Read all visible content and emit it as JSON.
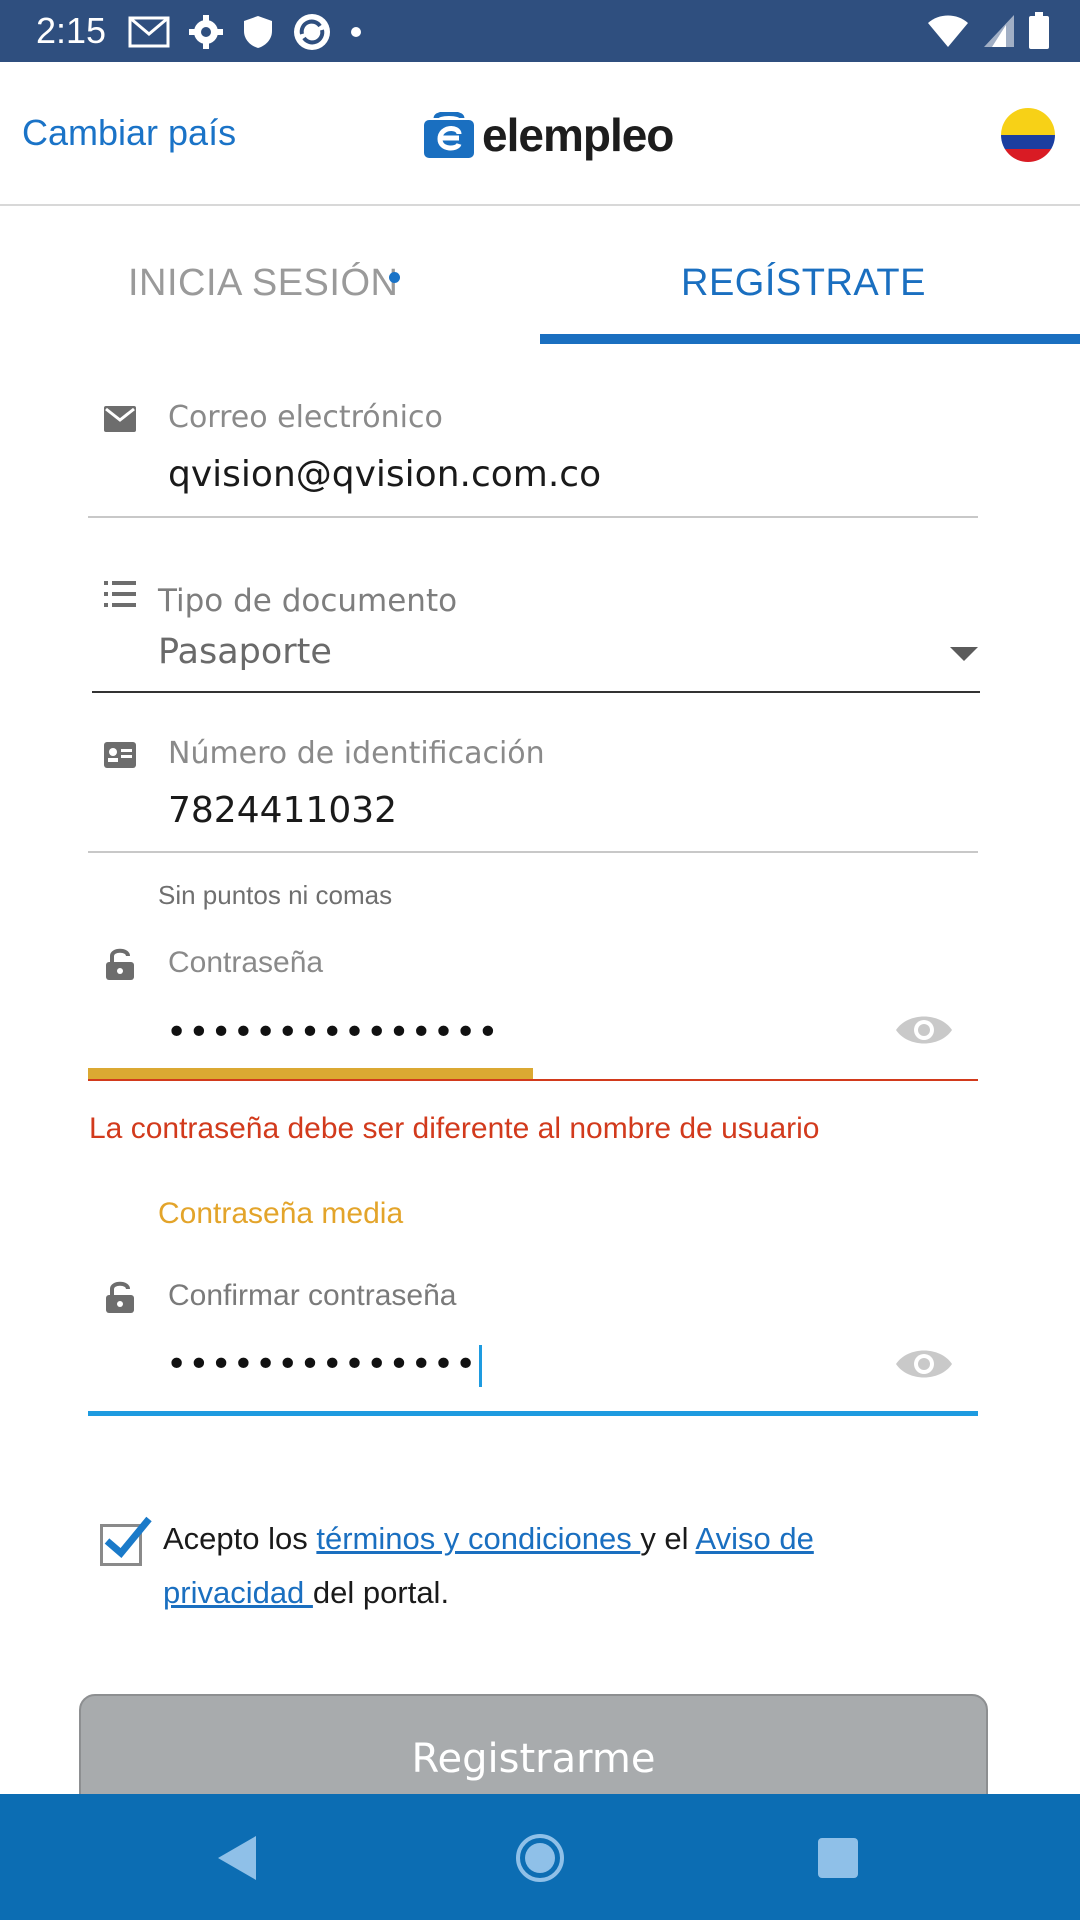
{
  "status_bar": {
    "time": "2:15",
    "left_icons": [
      "gmail-icon",
      "settings-icon",
      "shield-icon",
      "sync-icon",
      "dot-icon"
    ],
    "right_icons": [
      "wifi-icon",
      "signal-icon",
      "battery-icon"
    ]
  },
  "header": {
    "change_country_label": "Cambiar país",
    "logo_text": "elempleo",
    "flag": "colombia-flag"
  },
  "tabs": {
    "login_label": "INICIA SESIÓN",
    "register_label": "REGÍSTRATE",
    "active": "register"
  },
  "form": {
    "email": {
      "label": "Correo electrónico",
      "value": "qvision@qvision.com.co",
      "icon": "envelope-icon"
    },
    "document_type": {
      "label": "Tipo de documento",
      "value": "Pasaporte",
      "icon": "list-icon"
    },
    "id_number": {
      "label": "Número de identificación",
      "value": "7824411032",
      "helper": "Sin puntos ni comas",
      "icon": "id-card-icon"
    },
    "password": {
      "label": "Contraseña",
      "value": "•••••••••••••••",
      "error": "La contraseña debe ser diferente al nombre de usuario",
      "strength_label": "Contraseña media",
      "strength_fraction": 0.5,
      "icon": "lock-icon"
    },
    "confirm_password": {
      "label": "Confirmar contraseña",
      "value": "••••••••••••••",
      "icon": "lock-icon"
    },
    "terms": {
      "checked": true,
      "prefix": "Acepto los ",
      "link1": "términos y condiciones ",
      "middle": "y el ",
      "link2a": "Aviso de",
      "link2b": "privacidad ",
      "suffix": "del portal."
    },
    "submit_label": "Registrarme"
  },
  "colors": {
    "status_bar": "#2f4f7f",
    "accent": "#1a6fc0",
    "error": "#d23a1c",
    "strength_medium": "#e3a42a",
    "nav_bar": "#0c6db3"
  }
}
